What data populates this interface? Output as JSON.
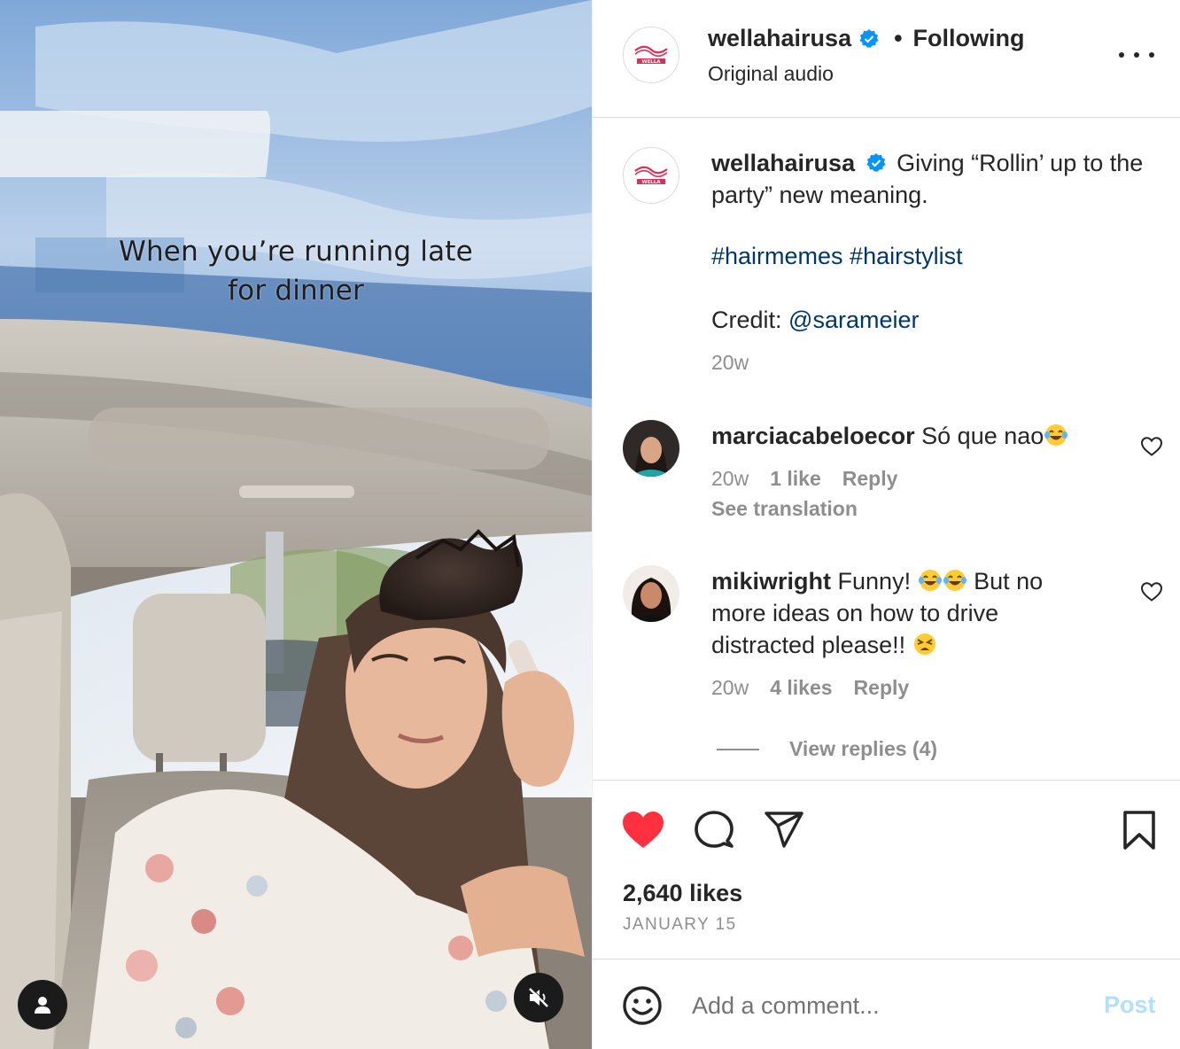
{
  "media": {
    "overlay_line1": "When you’re running late",
    "overlay_line2": "for dinner",
    "user_icon": "person-icon",
    "mute_icon": "speaker-muted-icon"
  },
  "header": {
    "username": "wellahairusa",
    "verified": true,
    "separator": "•",
    "follow_state": "Following",
    "audio": "Original audio",
    "more_icon": "more-horizontal-icon"
  },
  "caption": {
    "username": "wellahairusa",
    "text": "Giving “Rollin’ up to the party” new meaning.",
    "hashtags": "#hairmemes #hairstylist",
    "credit_label": "Credit:",
    "credit_handle": "@sarameier",
    "time": "20w"
  },
  "comments": [
    {
      "username": "marciacabeloecor",
      "text": "Só que nao",
      "time": "20w",
      "likes": "1 like",
      "reply": "Reply",
      "see_translation": "See translation"
    },
    {
      "username": "mikiwright",
      "text_part1": "Funny!",
      "text_part2": "But no more ideas on how to drive distracted please!!",
      "time": "20w",
      "likes": "4 likes",
      "reply": "Reply",
      "view_replies": "View replies (4)"
    }
  ],
  "actions": {
    "like_icon": "heart-filled-icon",
    "comment_icon": "comment-icon",
    "share_icon": "share-icon",
    "save_icon": "bookmark-icon",
    "likes": "2,640 likes",
    "date": "JANUARY 15",
    "like_color": "#ff3040"
  },
  "composer": {
    "placeholder": "Add a comment...",
    "post_label": "Post"
  },
  "colors": {
    "link": "#00376b",
    "muted": "#8e8e8e",
    "post_disabled": "#b2dffc",
    "verified": "#0095f6"
  }
}
